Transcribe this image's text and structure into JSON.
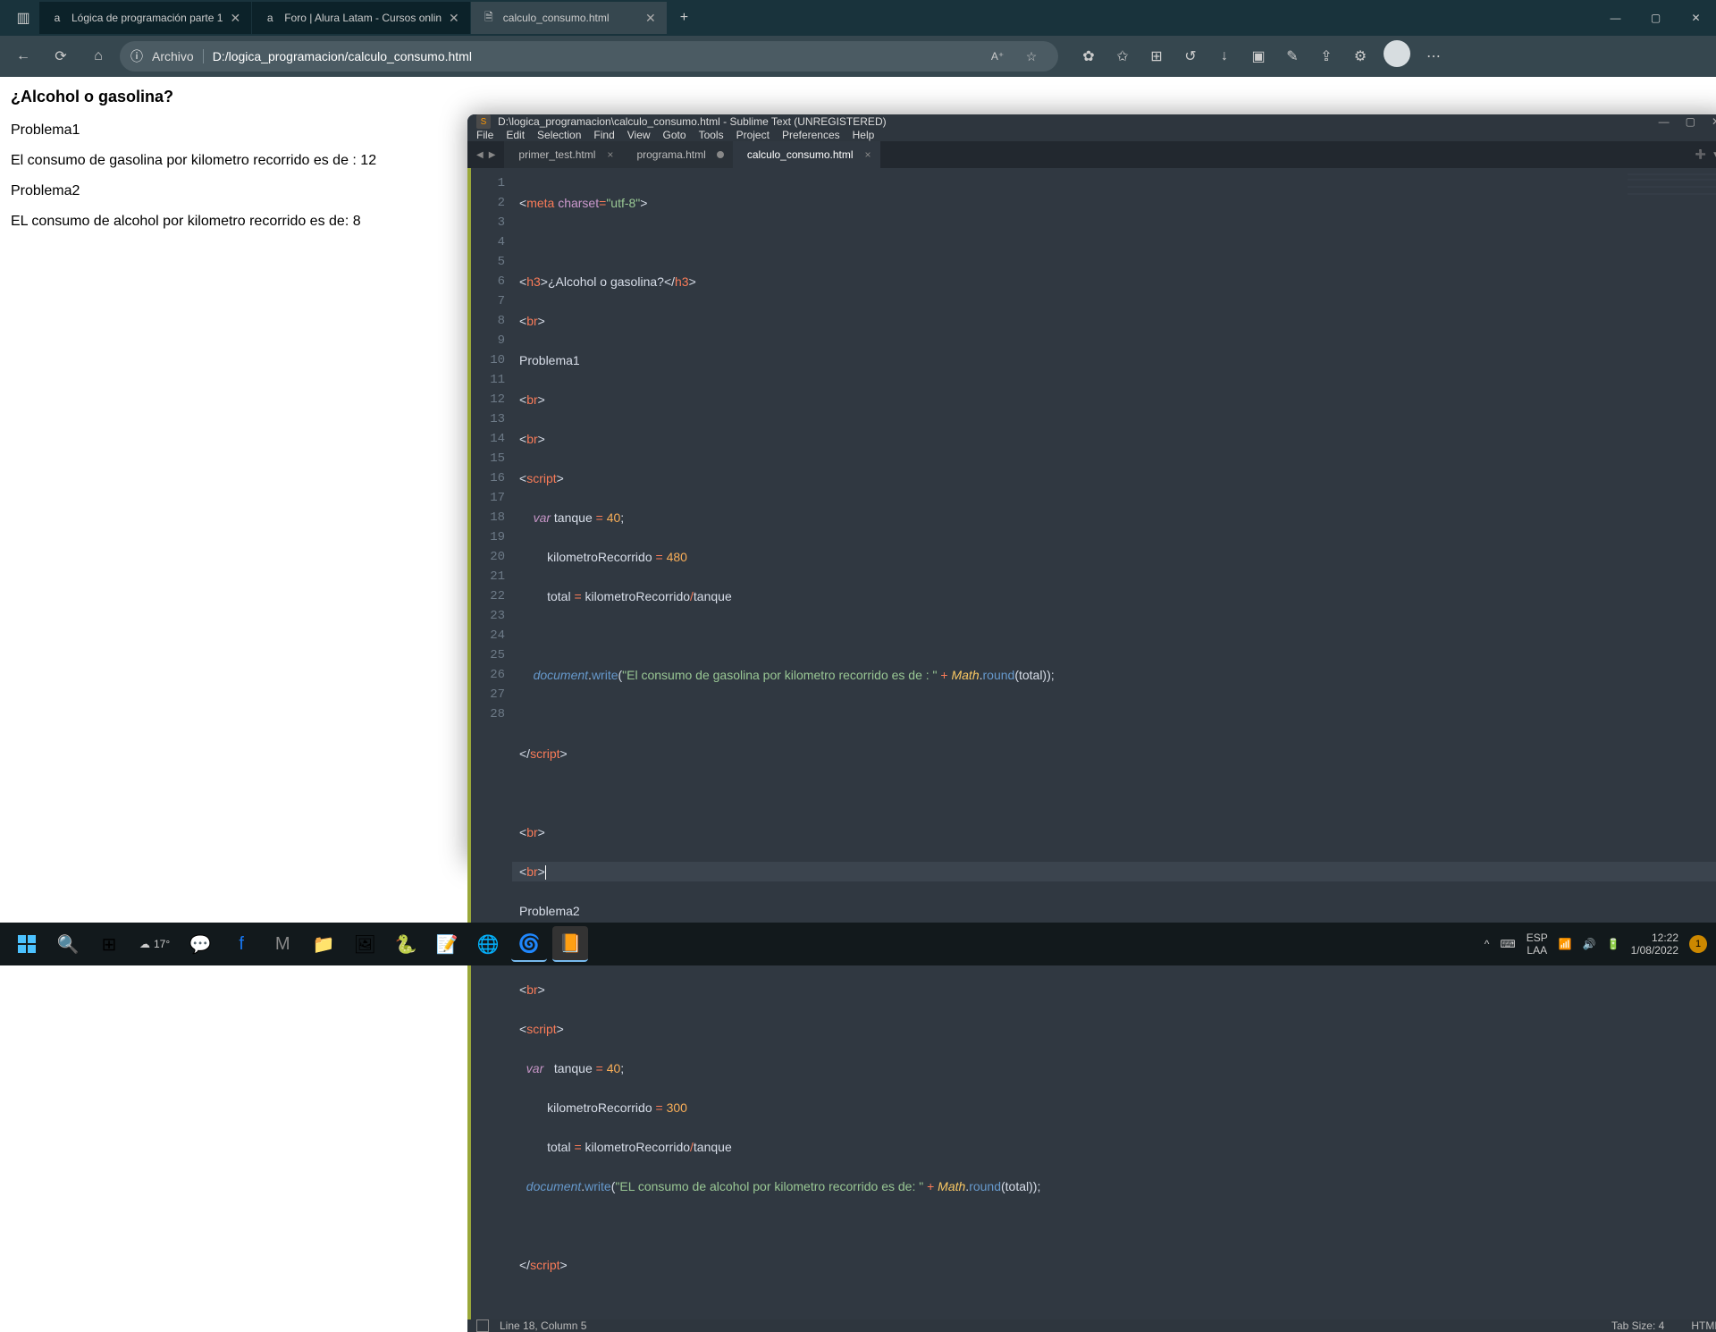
{
  "browser": {
    "tabs": [
      {
        "title": "Lógica de programación parte 1",
        "favicon": "a"
      },
      {
        "title": "Foro | Alura Latam - Cursos onlin",
        "favicon": "a"
      },
      {
        "title": "calculo_consumo.html",
        "favicon": "🗎",
        "active": true
      }
    ],
    "address_label": "Archivo",
    "address_path": "D:/logica_programacion/calculo_consumo.html"
  },
  "page": {
    "heading": "¿Alcohol o gasolina?",
    "p1": "Problema1",
    "p2": "El consumo de gasolina por kilometro recorrido es de : 12",
    "p3": "Problema2",
    "p4": "EL consumo de alcohol por kilometro recorrido es de: 8"
  },
  "sublime": {
    "title": "D:\\logica_programacion\\calculo_consumo.html - Sublime Text (UNREGISTERED)",
    "menu": [
      "File",
      "Edit",
      "Selection",
      "Find",
      "View",
      "Goto",
      "Tools",
      "Project",
      "Preferences",
      "Help"
    ],
    "tabs": [
      {
        "name": "primer_test.html"
      },
      {
        "name": "programa.html",
        "dirty": true
      },
      {
        "name": "calculo_consumo.html",
        "active": true
      }
    ],
    "status_left": "Line 18, Column 5",
    "status_tabsize": "Tab Size: 4",
    "status_syntax": "HTML",
    "lines": 28
  },
  "code": {
    "l1": {
      "a": "<",
      "b": "meta",
      "c": " charset",
      "d": "=",
      "e": "\"utf-8\"",
      "f": ">"
    },
    "l3": {
      "a": "<",
      "b": "h3",
      "c": ">",
      "d": "¿Alcohol o gasolina?",
      "e": "</",
      "f": "h3",
      "g": ">"
    },
    "l4": {
      "a": "<",
      "b": "br",
      "c": ">"
    },
    "l5": "Problema1",
    "l6": {
      "a": "<",
      "b": "br",
      "c": ">"
    },
    "l7": {
      "a": "<",
      "b": "br",
      "c": ">"
    },
    "l8": {
      "a": "<",
      "b": "script",
      "c": ">"
    },
    "l9": {
      "a": "    ",
      "b": "var",
      "c": " tanque ",
      "d": "=",
      "e": " ",
      "f": "40",
      "g": ";"
    },
    "l10": {
      "a": "        kilometroRecorrido ",
      "b": "=",
      "c": " ",
      "d": "480"
    },
    "l11": {
      "a": "        total ",
      "b": "=",
      "c": " kilometroRecorrido",
      "d": "/",
      "e": "tanque"
    },
    "l13": {
      "a": "    ",
      "b": "document",
      "c": ".",
      "d": "write",
      "e": "(",
      "f": "\"El consumo de gasolina por kilometro recorrido es de : \"",
      "g": " ",
      "h": "+",
      "i": " ",
      "j": "Math",
      "k": ".",
      "l": "round",
      "m": "(total));"
    },
    "l15": {
      "a": "</",
      "b": "script",
      "c": ">"
    },
    "l17": {
      "a": "<",
      "b": "br",
      "c": ">"
    },
    "l18": {
      "a": "<",
      "b": "br",
      "c": ">"
    },
    "l19": "Problema2",
    "l20": {
      "a": "<",
      "b": "br",
      "c": ">"
    },
    "l21": {
      "a": "<",
      "b": "br",
      "c": ">"
    },
    "l22": {
      "a": "<",
      "b": "script",
      "c": ">"
    },
    "l23": {
      "a": "  ",
      "b": "var",
      "c": "   tanque ",
      "d": "=",
      "e": " ",
      "f": "40",
      "g": ";"
    },
    "l24": {
      "a": "        kilometroRecorrido ",
      "b": "=",
      "c": " ",
      "d": "300"
    },
    "l25": {
      "a": "        total ",
      "b": "=",
      "c": " kilometroRecorrido",
      "d": "/",
      "e": "tanque"
    },
    "l26": {
      "a": "  ",
      "b": "document",
      "c": ".",
      "d": "write",
      "e": "(",
      "f": "\"EL consumo de alcohol por kilometro recorrido es de: \"",
      "g": " ",
      "h": "+",
      "i": " ",
      "j": "Math",
      "k": ".",
      "l": "round",
      "m": "(total));"
    },
    "l28": {
      "a": "</",
      "b": "script",
      "c": ">"
    }
  },
  "taskbar": {
    "weather_temp": "17°",
    "lang_top": "ESP",
    "lang_bot": "LAA",
    "time": "12:22",
    "date": "1/08/2022",
    "notif": "1"
  }
}
